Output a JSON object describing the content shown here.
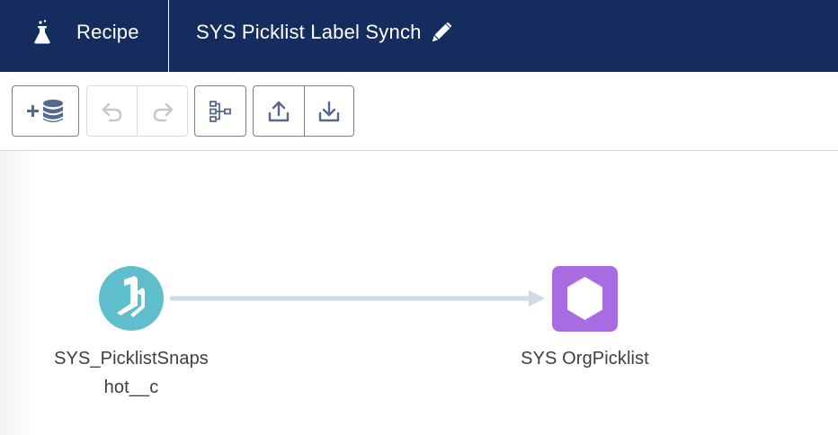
{
  "header": {
    "app_label": "Recipe",
    "title": "SYS Picklist Label Synch",
    "icons": {
      "app": "flask-icon",
      "edit": "pencil-icon"
    },
    "background": "#142d5e"
  },
  "toolbar": {
    "buttons": [
      {
        "name": "add-input-data-button",
        "icon": "plus-database-icon",
        "enabled": true
      },
      {
        "name": "undo-button",
        "icon": "undo-icon",
        "enabled": false
      },
      {
        "name": "redo-button",
        "icon": "redo-icon",
        "enabled": false
      },
      {
        "name": "graph-layout-button",
        "icon": "hierarchy-icon",
        "enabled": true
      },
      {
        "name": "upload-button",
        "icon": "upload-icon",
        "enabled": true
      },
      {
        "name": "download-button",
        "icon": "download-icon",
        "enabled": true
      }
    ]
  },
  "canvas": {
    "nodes": [
      {
        "name": "source-node",
        "label": "SYS_PicklistSnapshot__c",
        "label_line1": "SYS_PicklistSnaps",
        "label_line2": "hot__c",
        "icon": "input-dataset-icon",
        "color": "#5fbecc"
      },
      {
        "name": "target-node",
        "label": "SYS OrgPicklist",
        "icon": "output-hexagon-icon",
        "color": "#a86be1"
      }
    ],
    "edge_color": "#d0d9e4"
  }
}
